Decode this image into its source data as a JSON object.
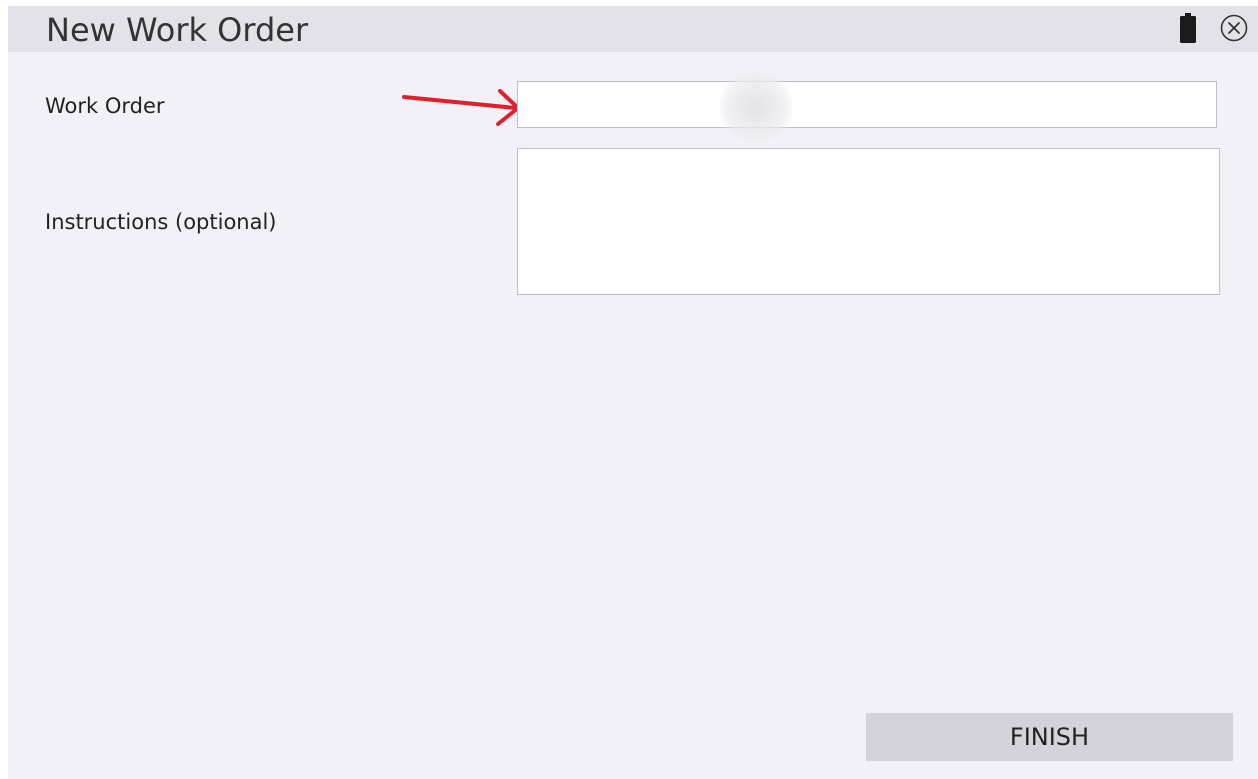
{
  "window": {
    "title": "New Work Order"
  },
  "icons": {
    "battery": "battery-icon",
    "close": "close-circle-icon",
    "annotation_arrow": "arrow-right-icon"
  },
  "form": {
    "work_order": {
      "label": "Work Order",
      "value": "",
      "placeholder": ""
    },
    "instructions": {
      "label": "Instructions (optional)",
      "value": "",
      "placeholder": ""
    }
  },
  "actions": {
    "finish_label": "FINISH"
  },
  "colors": {
    "background": "#f2f1f7",
    "titlebar": "#e3e2e8",
    "button": "#d4d3d9",
    "annotation_arrow": "#e0202e"
  }
}
